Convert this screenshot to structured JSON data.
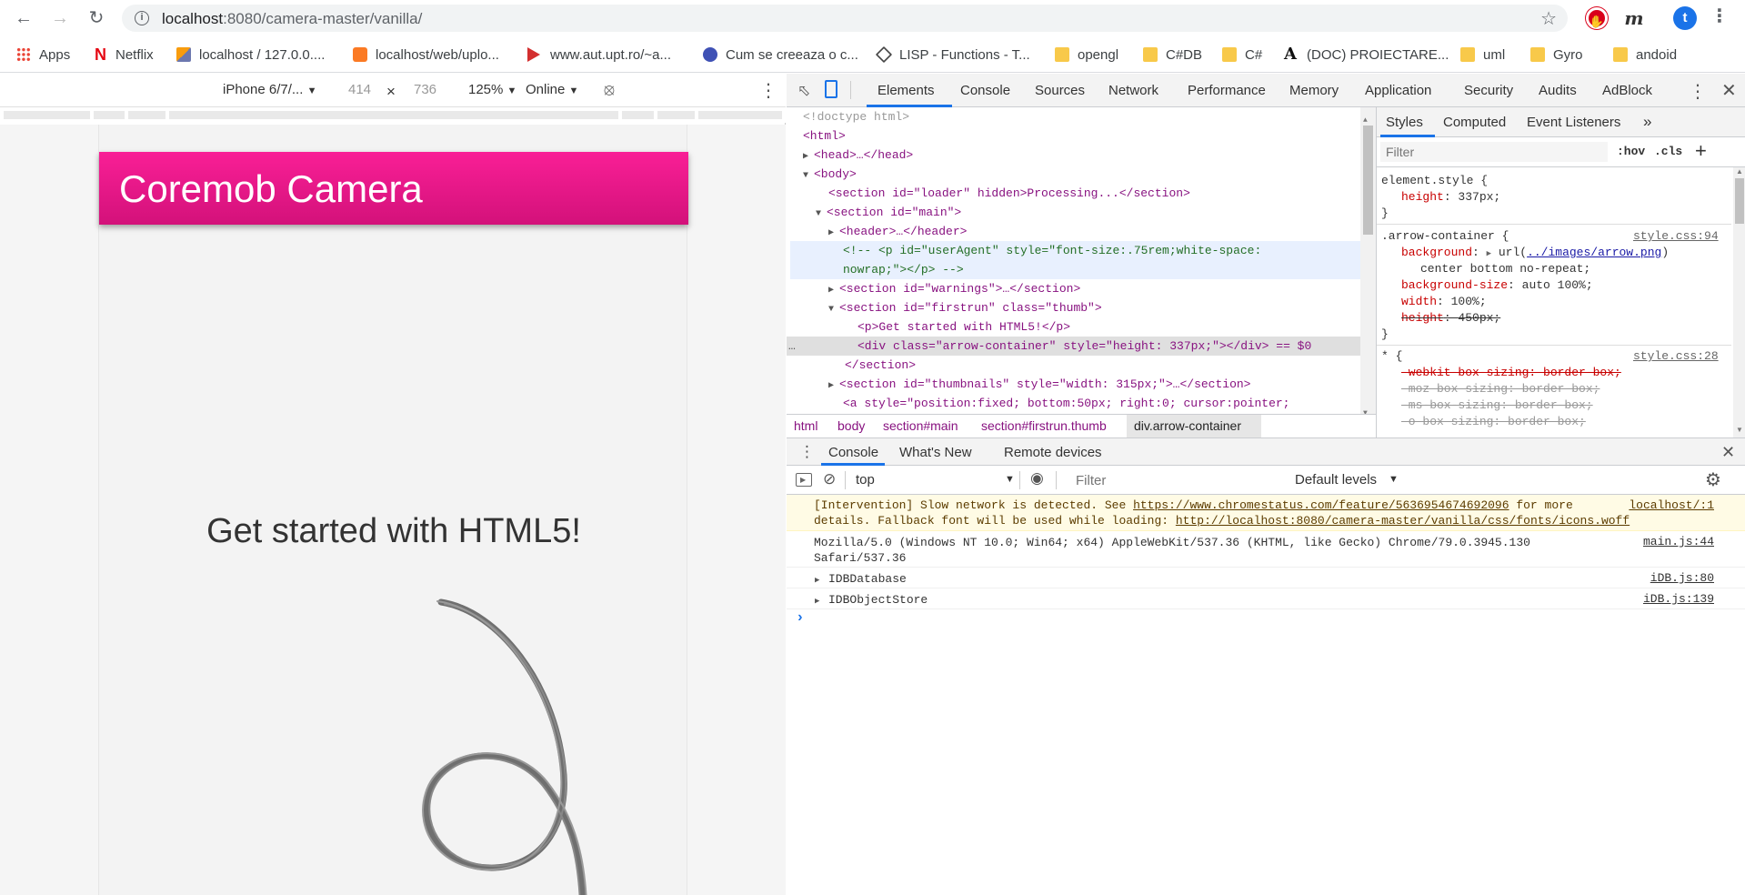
{
  "browser": {
    "url_host": "localhost",
    "url_port_path": ":8080/camera-master/vanilla/",
    "profile_initial": "t"
  },
  "bookmarks": [
    {
      "label": "Apps",
      "icon": "apps-grid-icon"
    },
    {
      "label": "Netflix",
      "icon": "netflix-icon"
    },
    {
      "label": "localhost / 127.0.0....",
      "icon": "phpmyadmin-icon"
    },
    {
      "label": "localhost/web/uplo...",
      "icon": "xampp-icon"
    },
    {
      "label": "www.aut.upt.ro/~a...",
      "icon": "play-red-icon"
    },
    {
      "label": "Cum se creeaza o c...",
      "icon": "globe-blue-icon"
    },
    {
      "label": "LISP - Functions - T...",
      "icon": "lisp-diamond-icon"
    },
    {
      "label": "opengl",
      "icon": "folder-icon"
    },
    {
      "label": "C#DB",
      "icon": "folder-icon"
    },
    {
      "label": "C#",
      "icon": "folder-icon"
    },
    {
      "label": "(DOC) PROIECTARE...",
      "icon": "academia-icon"
    },
    {
      "label": "uml",
      "icon": "folder-icon"
    },
    {
      "label": "Gyro",
      "icon": "folder-icon"
    },
    {
      "label": "andoid",
      "icon": "folder-icon"
    }
  ],
  "device_toolbar": {
    "device": "iPhone 6/7/...",
    "width": "414",
    "times": "×",
    "height": "736",
    "zoom": "125%",
    "network": "Online"
  },
  "app": {
    "header_title": "Coremob Camera",
    "get_started": "Get started with HTML5!"
  },
  "devtools": {
    "tabs": [
      "Elements",
      "Console",
      "Sources",
      "Network",
      "Performance",
      "Memory",
      "Application",
      "Security",
      "Audits",
      "AdBlock"
    ],
    "active_tab": "Elements",
    "dom_lines": [
      "<!doctype html>",
      "<html>",
      "<head>…</head>",
      "<body>",
      "<section id=\"loader\" hidden>Processing...</section>",
      "<section id=\"main\">",
      "<header>…</header>",
      "<!-- <p id=\"userAgent\" style=\"font-size:.75rem;white-space:",
      "nowrap;\"></p> -->",
      "<section id=\"warnings\">…</section>",
      "<section id=\"firstrun\" class=\"thumb\">",
      "<p>Get started with HTML5!</p>",
      "<div class=\"arrow-container\" style=\"height: 337px;\"></div> == $0",
      "</section>",
      "<section id=\"thumbnails\" style=\"width: 315px;\">…</section>",
      "<a style=\"position:fixed; bottom:50px; right:0; cursor:pointer;"
    ],
    "breadcrumbs": [
      "html",
      "body",
      "section#main",
      "section#firstrun.thumb",
      "div.arrow-container"
    ],
    "styles_tabs": [
      "Styles",
      "Computed",
      "Event Listeners",
      "»"
    ],
    "styles_filter_placeholder": "Filter",
    "hov": ":hov",
    "cls": ".cls",
    "plus": "+",
    "rules": {
      "element_style_selector": "element.style {",
      "element_style_prop": "height",
      "element_style_val": "337px;",
      "close": "}",
      "arrow_selector": ".arrow-container {",
      "arrow_src": "style.css:94",
      "bg_prop": "background",
      "bg_val_pre": "url(",
      "bg_val_link": "../images/arrow.png",
      "bg_val_post": ")",
      "bg_val_line2": "center bottom no-repeat;",
      "bgsize_prop": "background-size",
      "bgsize_val": "auto 100%;",
      "width_prop": "width",
      "width_val": "100%;",
      "height_prop": "height",
      "height_val": "450px;",
      "star_selector": "* {",
      "star_src": "style.css:28",
      "webkit": "-webkit-box-sizing: border-box;",
      "moz": "-moz-box-sizing: border-box;",
      "ms": "-ms-box-sizing: border-box;",
      "o": "-o-box-sizing: border-box;"
    },
    "drawer_tabs": [
      "Console",
      "What's New",
      "Remote devices"
    ],
    "console_context": "top",
    "console_filter_placeholder": "Filter",
    "console_levels": "Default levels",
    "messages": {
      "warn_text1": "[Intervention] Slow network is detected. See ",
      "warn_link1": "https://www.chromestatus.com/feature/5636954674692096",
      "warn_text2": " for more",
      "warn_src": "localhost/:1",
      "warn_text3": "details. Fallback font will be used while loading: ",
      "warn_link2": "http://localhost:8080/camera-master/vanilla/css/fonts/icons.woff",
      "ua_line1": "Mozilla/5.0 (Windows NT 10.0; Win64; x64) AppleWebKit/537.36 (KHTML, like Gecko) Chrome/79.0.3945.130",
      "ua_line2": "Safari/537.36",
      "ua_src": "main.js:44",
      "idb1": "IDBDatabase",
      "idb1_src": "iDB.js:80",
      "idb2": "IDBObjectStore",
      "idb2_src": "iDB.js:139",
      "prompt": "›"
    }
  }
}
